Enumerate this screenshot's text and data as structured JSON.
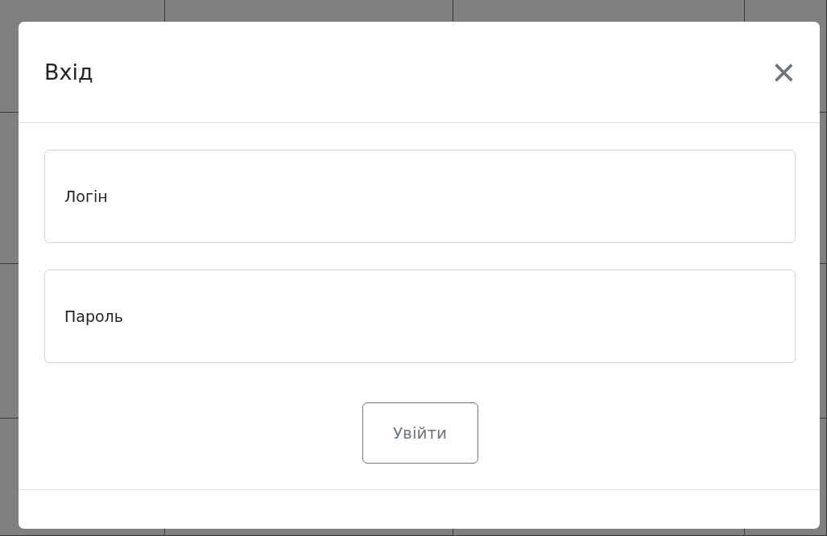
{
  "dialog": {
    "title": "Вхід",
    "close_icon": "×"
  },
  "fields": [
    {
      "placeholder": "Логін"
    },
    {
      "placeholder": "Пароль"
    }
  ],
  "submit": {
    "label": "Увійти"
  }
}
